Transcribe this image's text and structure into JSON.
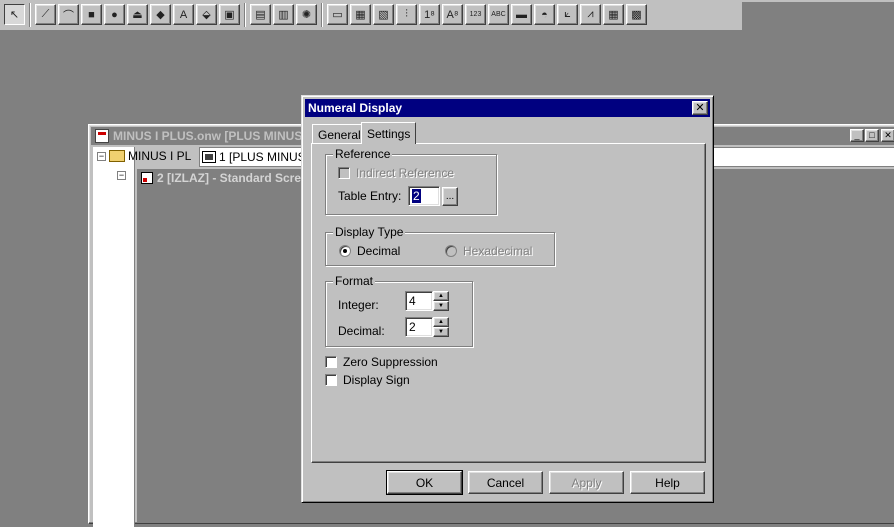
{
  "toolbar": {
    "tools": [
      {
        "name": "select-arrow-icon",
        "glyph": "↖"
      },
      {
        "name": "polyline-icon",
        "glyph": "⟋"
      },
      {
        "name": "arc-icon",
        "glyph": "⌒"
      },
      {
        "name": "rectangle-icon",
        "glyph": "■"
      },
      {
        "name": "ellipse-icon",
        "glyph": "●"
      },
      {
        "name": "polygon-icon",
        "glyph": "⏏"
      },
      {
        "name": "diamond-icon",
        "glyph": "◆"
      },
      {
        "name": "text-icon",
        "glyph": "A"
      },
      {
        "name": "fill-icon",
        "glyph": "⬙"
      },
      {
        "name": "bitmap-icon",
        "glyph": "▣"
      },
      {
        "name": "picture-icon",
        "glyph": "▤"
      },
      {
        "name": "image-icon",
        "glyph": "▥"
      },
      {
        "name": "lamp-icon",
        "glyph": "✺"
      },
      {
        "name": "button-icon",
        "glyph": "▭"
      },
      {
        "name": "toggle-icon",
        "glyph": "▦"
      },
      {
        "name": "switch-icon",
        "glyph": "▧"
      },
      {
        "name": "slider-icon",
        "glyph": "⫶"
      },
      {
        "name": "numeral-display-icon",
        "glyph": "1⁸"
      },
      {
        "name": "ascii-display-icon",
        "glyph": "A⁸"
      },
      {
        "name": "numeral-input-icon",
        "glyph": "123"
      },
      {
        "name": "ascii-input-icon",
        "glyph": "ABC"
      },
      {
        "name": "message-icon",
        "glyph": "▬"
      },
      {
        "name": "gauge-icon",
        "glyph": "◓"
      },
      {
        "name": "trend-icon",
        "glyph": "⟀"
      },
      {
        "name": "graph-icon",
        "glyph": "⩘"
      },
      {
        "name": "table-icon",
        "glyph": "▦"
      },
      {
        "name": "grid-icon",
        "glyph": "▩"
      }
    ]
  },
  "mdi": {
    "title": "MINUS I PLUS.onw [PLUS MINUS",
    "controls": {
      "minimize": "_",
      "maximize": "□",
      "close": "✕"
    },
    "tree_root": "MINUS I PL",
    "tree_expander": "−",
    "screen_tab": "1 [PLUS MINUS]",
    "subwindow_title": "2 [IZLAZ] - Standard Scre"
  },
  "dialog": {
    "title": "Numeral Display",
    "close_glyph": "✕",
    "tabs": [
      {
        "label": "General"
      },
      {
        "label": "Settings"
      }
    ],
    "reference": {
      "group_label": "Reference",
      "indirect_label": "Indirect Reference",
      "table_entry_label": "Table Entry:",
      "table_entry_value": "2",
      "browse_label": "..."
    },
    "display_type": {
      "group_label": "Display Type",
      "decimal_label": "Decimal",
      "hex_label": "Hexadecimal"
    },
    "format": {
      "group_label": "Format",
      "integer_label": "Integer:",
      "integer_value": "4",
      "decimal_label": "Decimal:",
      "decimal_value": "2",
      "spin_up": "▲",
      "spin_down": "▼"
    },
    "zero_suppression_label": "Zero Suppression",
    "display_sign_label": "Display Sign",
    "buttons": {
      "ok": "OK",
      "cancel": "Cancel",
      "apply": "Apply",
      "help": "Help"
    }
  }
}
